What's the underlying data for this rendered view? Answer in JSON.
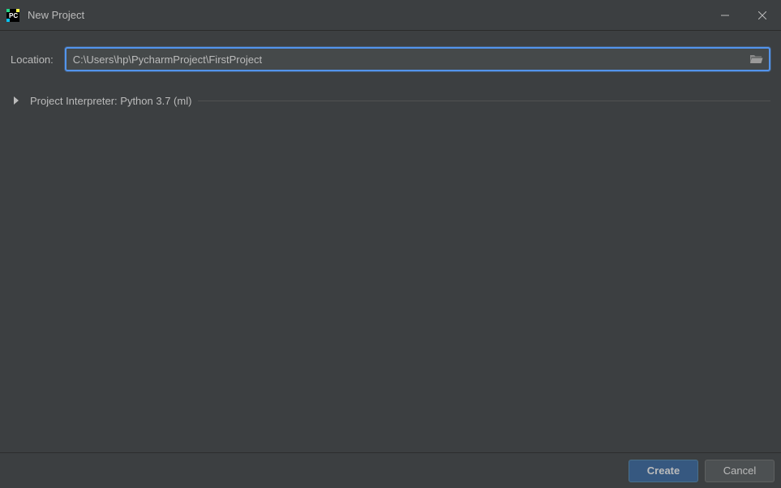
{
  "window": {
    "title": "New Project"
  },
  "form": {
    "location_label": "Location:",
    "location_value": "C:\\Users\\hp\\PycharmProject\\FirstProject",
    "interpreter_label": "Project Interpreter: Python 3.7 (ml)"
  },
  "buttons": {
    "create": "Create",
    "cancel": "Cancel"
  }
}
